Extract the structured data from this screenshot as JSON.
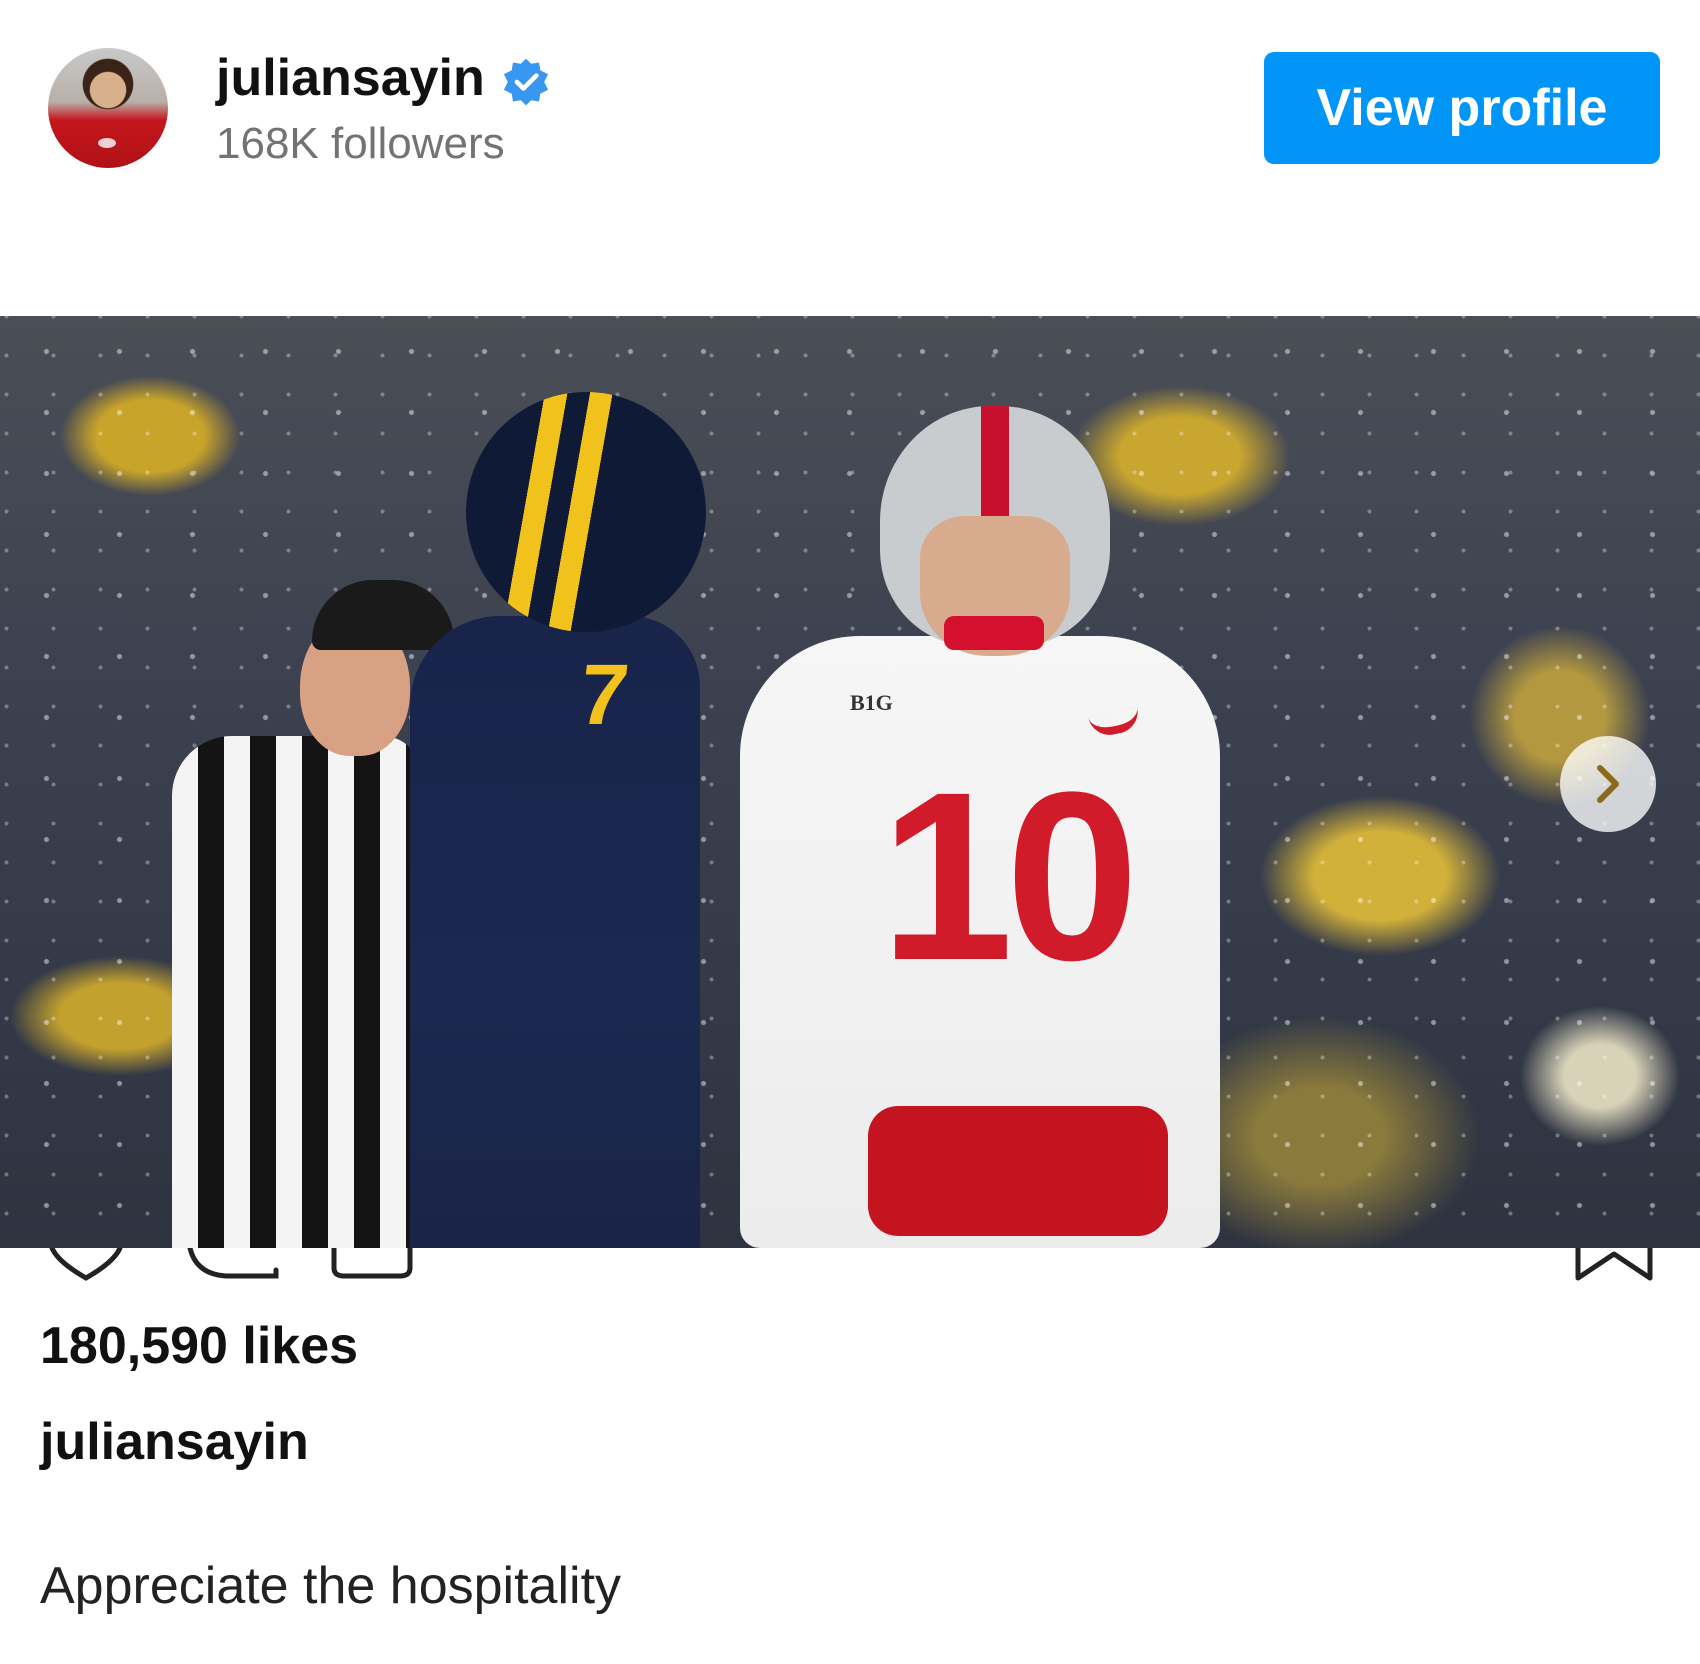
{
  "header": {
    "username": "juliansayin",
    "verified": true,
    "followers": "168K followers",
    "view_profile_label": "View profile"
  },
  "post": {
    "media": {
      "jersey_numbers": [
        "7",
        "10"
      ],
      "conference_logo_text": "B1G",
      "carousel_next_icon": "chevron-right-icon"
    },
    "actions": [
      "heart-icon",
      "comment-icon",
      "share-icon",
      "bookmark-icon"
    ],
    "likes": "180,590 likes",
    "caption_user": "juliansayin",
    "caption_text": "Appreciate the hospitality"
  },
  "colors": {
    "accent": "#0095f6",
    "verified_badge": "#3897f0",
    "secondary_text": "#737373",
    "osu_red": "#d11a2a",
    "michigan_maize": "#f1c21c",
    "michigan_blue": "#18244a"
  }
}
